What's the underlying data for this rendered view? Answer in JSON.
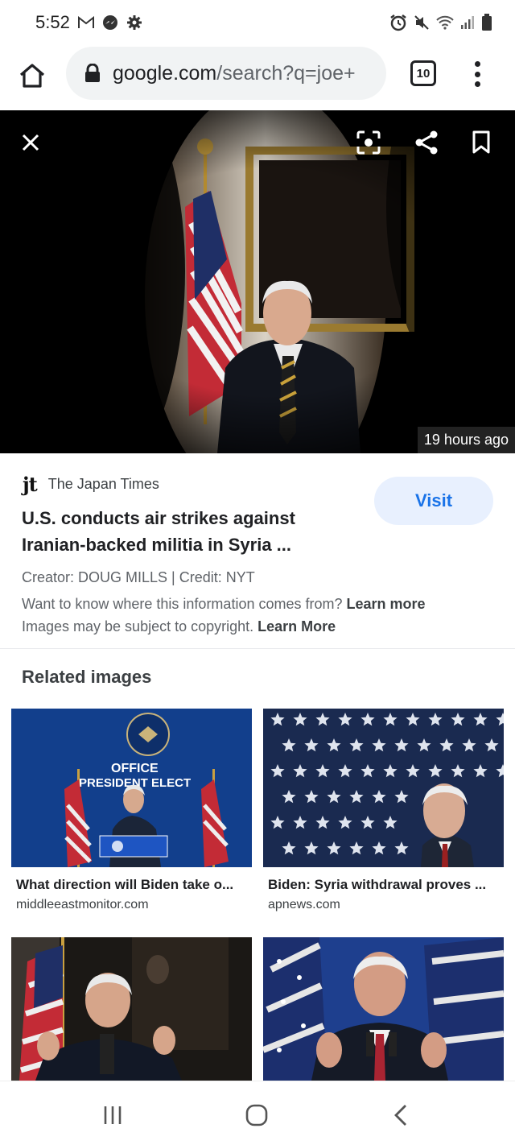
{
  "status_bar": {
    "time": "5:52",
    "left_icons": [
      "gmail-icon",
      "messenger-icon",
      "settings-gear-icon"
    ],
    "right_icons": [
      "alarm-icon",
      "mute-icon",
      "wifi-icon",
      "signal-icon",
      "battery-icon"
    ]
  },
  "browser": {
    "url_domain": "google.com",
    "url_path": "/search?q=joe+",
    "tab_count": "10"
  },
  "viewer": {
    "timestamp": "19 hours ago",
    "icons": [
      "close-icon",
      "lens-icon",
      "share-icon",
      "bookmark-icon"
    ]
  },
  "result": {
    "source_logo": "jt",
    "source_name": "The Japan Times",
    "title_line1": "U.S. conducts air strikes against",
    "title_line2": "Iranian-backed militia in Syria ...",
    "visit_label": "Visit",
    "creator": "Creator: DOUG MILLS | Credit: NYT",
    "info_text": "Want to know where this information comes from?",
    "info_link": "Learn more",
    "copyright_text": "Images may be subject to copyright.",
    "copyright_link": "Learn More"
  },
  "related": {
    "heading": "Related images",
    "items": [
      {
        "title": "What direction will Biden take o...",
        "site": "middleeastmonitor.com",
        "sign_line1": "OFFICE",
        "sign_line2": "PRESIDENT ELECT"
      },
      {
        "title": "Biden: Syria withdrawal proves ...",
        "site": "apnews.com"
      },
      {
        "title": "",
        "site": ""
      },
      {
        "title": "",
        "site": ""
      }
    ]
  },
  "navbar": {
    "icons": [
      "recent-apps-icon",
      "home-icon",
      "back-icon"
    ]
  },
  "colors": {
    "accent": "#1a73e8",
    "visit_bg": "#e8f0fe",
    "url_bg": "#f1f3f4"
  }
}
